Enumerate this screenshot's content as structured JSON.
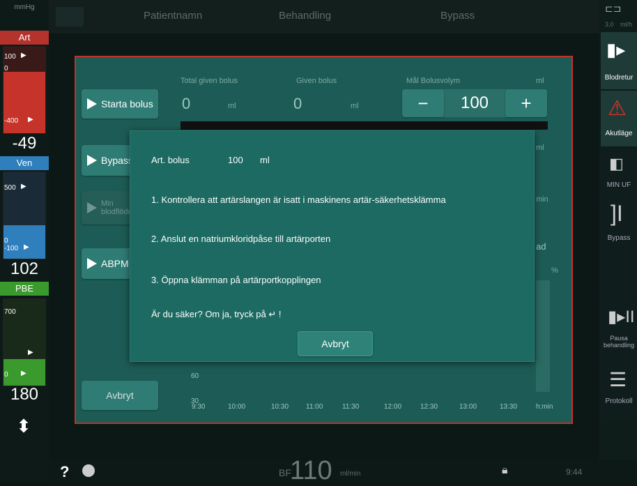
{
  "left_panel": {
    "unit": "mmHg",
    "art": {
      "label": "Art",
      "top_tick": "100",
      "zero_tick": "0",
      "bottom_tick": "-400",
      "value": "-49"
    },
    "ven": {
      "label": "Ven",
      "top_tick": "500",
      "zero_tick": "0",
      "bottom_tick": "-100",
      "value": "102"
    },
    "pbe": {
      "label": "PBE",
      "top_tick": "700",
      "bottom_tick": "0",
      "value": "180"
    }
  },
  "header": {
    "patient": "Patientnamn",
    "treatment": "Behandling",
    "mode": "Bypass"
  },
  "right_panel": {
    "top_value": "3,0",
    "top_unit": "ml/h",
    "blood_return": "Blodretur",
    "emergency": "Akutläge",
    "min_uf": "MIN UF",
    "bypass": "Bypass",
    "pause": "Pausa behandling",
    "protocol": "Protokoll"
  },
  "panel": {
    "start_bolus": "Starta bolus",
    "bypass_btn": "Bypass",
    "min_btn": "Min blodflöde",
    "abpm_btn": "ABPM",
    "cancel": "Avbryt",
    "total_given_label": "Total given bolus",
    "total_given_value": "0",
    "given_label": "Given bolus",
    "given_value": "0",
    "unit_ml": "ml",
    "target_label": "Mål Bolusvolym",
    "target_value": "100",
    "minus": "−",
    "plus": "+",
    "side_ml": "ml",
    "side_min": "min",
    "side_ad": "ad",
    "side_pct": "%",
    "y60": "60",
    "y30": "30",
    "times": [
      "9:30",
      "10:00",
      "10:30",
      "11:00",
      "11:30",
      "12:00",
      "12:30",
      "13:00",
      "13:30",
      "h:min"
    ]
  },
  "dialog": {
    "title_label": "Art. bolus",
    "title_value": "100",
    "title_unit": "ml",
    "step1": "1. Kontrollera att artärslangen är isatt i maskinens artär-säkerhetsklämma",
    "step2": "2. Anslut en natriumkloridpåse till artärporten",
    "step3": "3. Öppna klämman på artärportkopplingen",
    "question": "Är du säker? Om ja, tryck på ↵ !",
    "cancel": "Avbryt"
  },
  "footer": {
    "help": "?",
    "bf_label": "BF",
    "bf_value": "110",
    "bf_unit": "ml/min",
    "time": "9:44"
  }
}
